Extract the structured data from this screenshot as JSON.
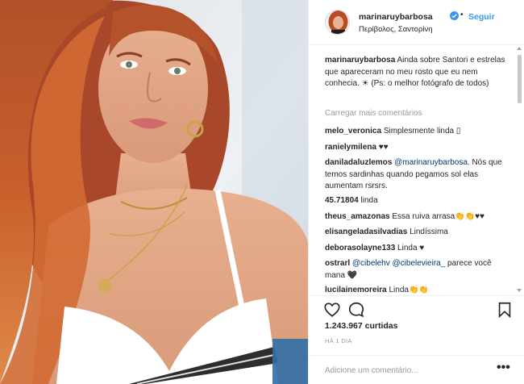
{
  "header": {
    "username": "marinaruybarbosa",
    "separator": "•",
    "follow_label": "Seguir",
    "location": "Περίβολος, Σαντορίνη"
  },
  "caption": {
    "username": "marinaruybarbosa",
    "text": "Ainda sobre Santori e estrelas que apareceram no meu rosto que eu nem conhecia. ☀ (Ps: o melhor fotógrafo de todos)"
  },
  "load_more_label": "Carregar mais comentários",
  "comments": [
    {
      "user": "melo_veronica",
      "text": "Simplesmente linda ▯"
    },
    {
      "user": "ranielymilena",
      "text": "♥♥"
    },
    {
      "user": "daniladaluzlemos",
      "mention": "@marinaruybarbosa",
      "text": ". Nós que temos sardinhas quando pegamos sol elas aumentam rsrsrs."
    },
    {
      "user": "45.71804",
      "text": "linda"
    },
    {
      "user": "theus_amazonas",
      "text": "Essa ruiva arrasa👏👏♥♥"
    },
    {
      "user": "elisangeladasilvadias",
      "text": "Lindíssima"
    },
    {
      "user": "deborasolayne133",
      "text": "Linda ♥"
    },
    {
      "user": "ostrarl",
      "mention": "@cibelehv",
      "mention2": "@cibelevieira_",
      "text": " parece você mana 🖤"
    },
    {
      "user": "lucilainemoreira",
      "text": "Linda👏👏"
    }
  ],
  "likes_text": "1.243.967 curtidas",
  "time_ago": "HÁ 1 DIA",
  "add_comment_placeholder": "Adicione um comentário...",
  "more_options_label": "•••",
  "icons": {
    "verified": "verified-badge-icon",
    "like": "heart-icon",
    "comment": "comment-bubble-icon",
    "save": "bookmark-icon",
    "more": "more-options-icon"
  },
  "colors": {
    "link_blue": "#3897f0",
    "mention_blue": "#003569",
    "muted_gray": "#999999",
    "text_dark": "#262626",
    "hair_red": "#c2502a"
  }
}
